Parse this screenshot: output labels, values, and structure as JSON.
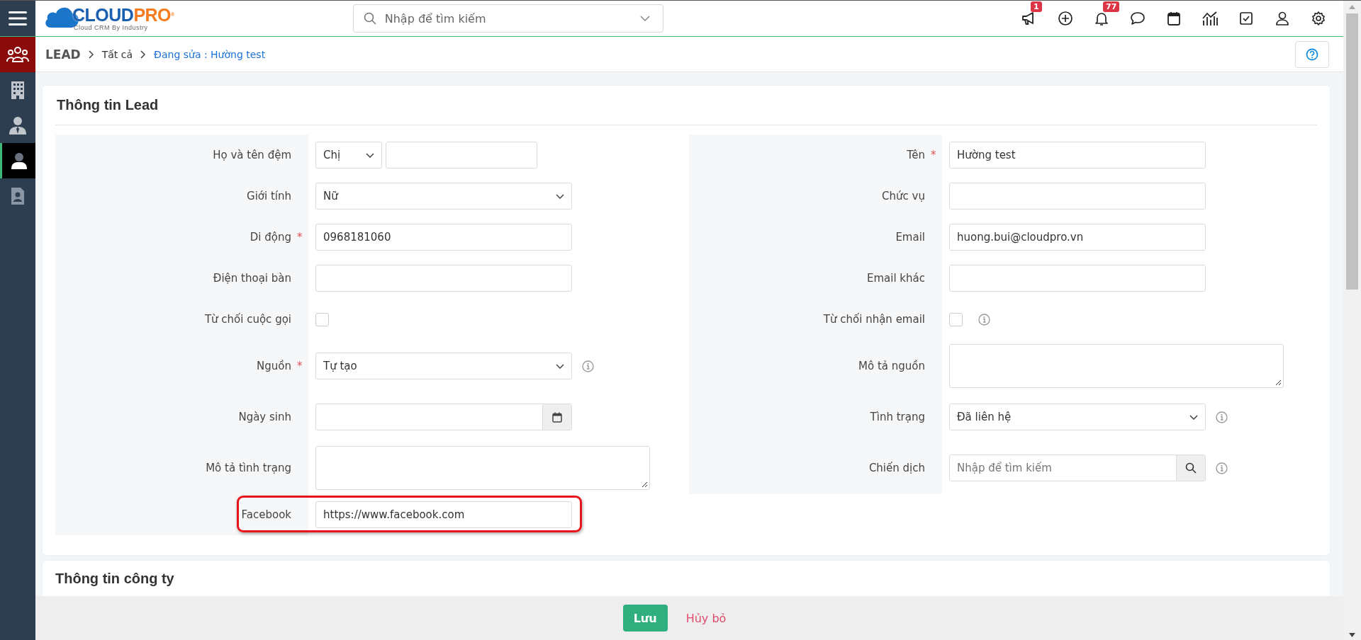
{
  "required_mark": "*",
  "header": {
    "logo": {
      "word_1": "CLOUD",
      "word_2": "PRO",
      "mark": "®",
      "tagline": "Cloud CRM By Industry"
    },
    "search": {
      "placeholder": "Nhập để tìm kiếm"
    },
    "icons": [
      {
        "kind": "megaphone",
        "badge": "1"
      },
      {
        "kind": "plus"
      },
      {
        "kind": "bell",
        "badge": "77"
      },
      {
        "kind": "chat"
      },
      {
        "kind": "calendar"
      },
      {
        "kind": "chart"
      },
      {
        "kind": "task"
      },
      {
        "kind": "user"
      },
      {
        "kind": "gear"
      }
    ]
  },
  "sidebar": {
    "items": [
      {
        "kind": "people",
        "selected": false
      },
      {
        "kind": "building",
        "selected": false
      },
      {
        "kind": "agent",
        "selected": false
      },
      {
        "kind": "person",
        "selected": true
      },
      {
        "kind": "contact",
        "selected": false
      }
    ]
  },
  "breadcrumb": {
    "module": "LEAD",
    "items": [
      "Tất cả",
      "Đang sửa : Hường test"
    ]
  },
  "sections": [
    {
      "title": "Thông tin Lead",
      "left": [
        {
          "label": "Họ và tên đệm",
          "required": false,
          "kind": "salutation",
          "value": "Chị",
          "info": false,
          "highlighted": false
        },
        {
          "label": "Giới tính",
          "required": false,
          "kind": "select",
          "value": "Nữ",
          "info": false,
          "highlighted": false
        },
        {
          "label": "Di động",
          "required": true,
          "kind": "text",
          "value": "0968181060",
          "info": false,
          "highlighted": false
        },
        {
          "label": "Điện thoại bàn",
          "required": false,
          "kind": "text",
          "info": false,
          "highlighted": false
        },
        {
          "label": "Từ chối cuộc gọi",
          "required": false,
          "kind": "checkbox",
          "checked": false,
          "info": false,
          "highlighted": false
        },
        {
          "label": "Nguồn",
          "required": true,
          "kind": "select",
          "value": "Tự tạo",
          "info": true,
          "highlighted": false
        },
        {
          "label": "Ngày sinh",
          "required": false,
          "kind": "date",
          "info": false,
          "highlighted": false
        },
        {
          "label": "Mô tả tình trạng",
          "required": false,
          "kind": "textarea",
          "info": false,
          "highlighted": false
        },
        {
          "label": "Facebook",
          "required": false,
          "kind": "text",
          "value": "https://www.facebook.com",
          "info": false,
          "highlighted": true
        }
      ],
      "right": [
        {
          "label": "Tên",
          "required": true,
          "kind": "text",
          "value": "Hường test",
          "info": false,
          "highlighted": false
        },
        {
          "label": "Chức vụ",
          "required": false,
          "kind": "text",
          "info": false,
          "highlighted": false
        },
        {
          "label": "Email",
          "required": false,
          "kind": "text",
          "value": "huong.bui@cloudpro.vn",
          "info": false,
          "highlighted": false
        },
        {
          "label": "Email khác",
          "required": false,
          "kind": "text",
          "info": false,
          "highlighted": false
        },
        {
          "label": "Từ chối nhận email",
          "required": false,
          "kind": "checkbox",
          "checked": false,
          "info": true,
          "highlighted": false
        },
        {
          "label": "Mô tả nguồn",
          "required": false,
          "kind": "textarea",
          "info": false,
          "highlighted": false
        },
        {
          "label": "Tình trạng",
          "required": false,
          "kind": "select",
          "value": "Đã liên hệ",
          "info": true,
          "highlighted": false
        },
        {
          "label": "Chiến dịch",
          "required": false,
          "kind": "lookup",
          "placeholder": "Nhập để tìm kiếm",
          "info": true,
          "highlighted": false
        }
      ]
    },
    {
      "title": "Thông tin công ty"
    }
  ],
  "footer": {
    "save": "Lưu",
    "cancel": "Hủy bỏ"
  }
}
